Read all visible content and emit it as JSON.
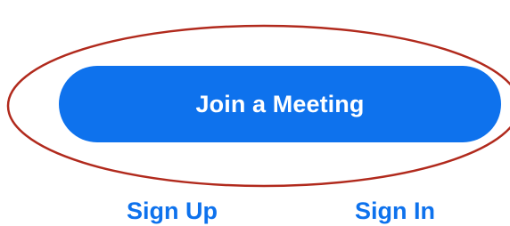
{
  "colors": {
    "accent": "#0e72ed",
    "accent_text": "#ffffff",
    "annotation": "#b12a1d",
    "background": "#ffffff"
  },
  "main": {
    "join_button_label": "Join a Meeting"
  },
  "footer": {
    "sign_up_label": "Sign Up",
    "sign_in_label": "Sign In"
  },
  "annotation": {
    "shape": "ellipse-outline"
  }
}
